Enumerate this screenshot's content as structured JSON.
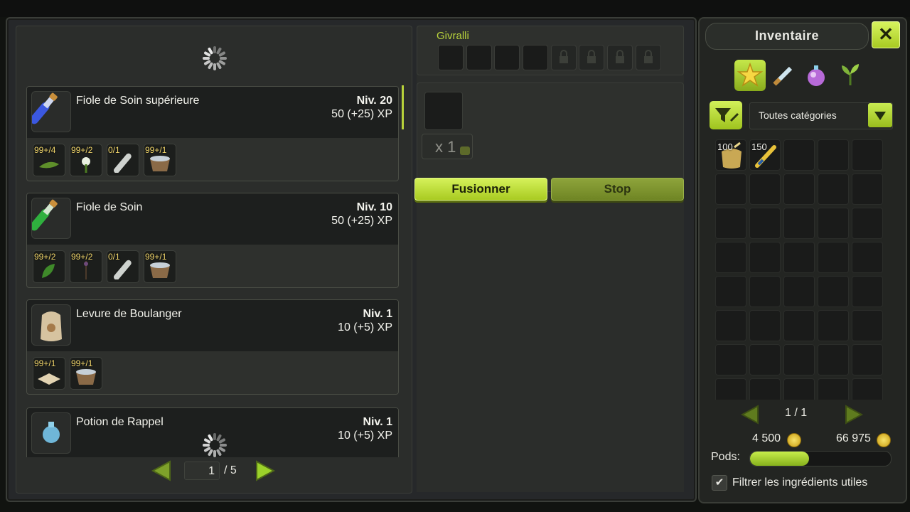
{
  "recipes": {
    "items": [
      {
        "name": "Fiole de Soin supérieure",
        "level": "Niv. 20",
        "xp": "50 (+25) XP",
        "ingredients": [
          {
            "qty": "99+/4",
            "icon": "herb-icon"
          },
          {
            "qty": "99+/2",
            "icon": "flower-icon"
          },
          {
            "qty": "0/1",
            "icon": "empty-vial-icon"
          },
          {
            "qty": "99+/1",
            "icon": "bucket-icon"
          }
        ],
        "icon": "blue-potion-icon"
      },
      {
        "name": "Fiole de Soin",
        "level": "Niv. 10",
        "xp": "50 (+25) XP",
        "ingredients": [
          {
            "qty": "99+/2",
            "icon": "leaf-icon"
          },
          {
            "qty": "99+/2",
            "icon": "sprig-icon"
          },
          {
            "qty": "0/1",
            "icon": "empty-vial-icon"
          },
          {
            "qty": "99+/1",
            "icon": "bucket-icon"
          }
        ],
        "icon": "green-potion-icon"
      },
      {
        "name": "Levure de Boulanger",
        "level": "Niv. 1",
        "xp": "10 (+5) XP",
        "ingredients": [
          {
            "qty": "99+/1",
            "icon": "flour-icon"
          },
          {
            "qty": "99+/1",
            "icon": "bucket-icon"
          }
        ],
        "icon": "flour-sack-icon"
      },
      {
        "name": "Potion de Rappel",
        "level": "Niv. 1",
        "xp": "10 (+5) XP",
        "ingredients": [],
        "icon": "recall-potion-icon"
      }
    ],
    "page_current": "1",
    "page_total": "/ 5"
  },
  "craft": {
    "owner": "Givralli",
    "quantity": "x 1",
    "fuse_label": "Fusionner",
    "stop_label": "Stop"
  },
  "inventory": {
    "title": "Inventaire",
    "close": "✕",
    "category": "Toutes catégories",
    "items": [
      {
        "count": "100",
        "icon": "grain-sack-icon"
      },
      {
        "count": "150",
        "icon": "quill-icon"
      }
    ],
    "page": "1 / 1",
    "kamas_left": "4 500",
    "kamas_right": "66 975",
    "pods_label": "Pods:",
    "pods_fraction": 0.42,
    "filter_label": "Filtrer les ingrédients utiles",
    "filter_checked": "✔"
  },
  "colors": {
    "accent": "#b9d33c",
    "panel": "#2b2d2b",
    "dark": "#1a1b1a"
  }
}
